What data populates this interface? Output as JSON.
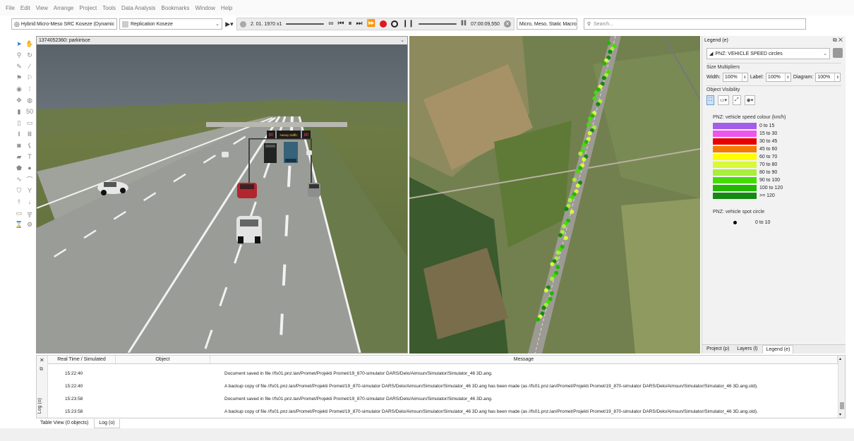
{
  "menu": [
    "File",
    "Edit",
    "View",
    "Arrange",
    "Project",
    "Tools",
    "Data Analysis",
    "Bookmarks",
    "Window",
    "Help"
  ],
  "toolbar": {
    "scenario": "Hybrid Micro-Meso SRC Koseze (Dynamic",
    "replication": "Replication Koseze",
    "date_speed": "2. 01. 1970 x1",
    "infinity": "∞",
    "time": "07:00:09,550",
    "engine": "Micro, Meso, Static Macro",
    "search_placeholder": "Search..."
  },
  "view3d": {
    "title": "1374052360: parkirisce",
    "sign_label": "Heavy traffic",
    "sign_speed": "80"
  },
  "legend": {
    "title": "Legend (e)",
    "selector": "PNZ: VEHICLE SPEED circles",
    "size_multipliers": "Size Multipliers",
    "width_label": "Width:",
    "width_value": "100%",
    "label_label": "Label:",
    "label_value": "100%",
    "diagram_label": "Diagram:",
    "diagram_value": "100%",
    "object_visibility": "Object Visibility",
    "speed_title": "PNZ: vehicle speed colour (km/h)",
    "speed_ranges": [
      {
        "label": "0 to 15",
        "color": "#a35de8"
      },
      {
        "label": "15 to 30",
        "color": "#ee55ee"
      },
      {
        "label": "30 to 45",
        "color": "#e80000"
      },
      {
        "label": "45 to 60",
        "color": "#f47a00"
      },
      {
        "label": "60 to 70",
        "color": "#ffff00"
      },
      {
        "label": "70 to 80",
        "color": "#d8f83a"
      },
      {
        "label": "80 to 90",
        "color": "#a8ee3a"
      },
      {
        "label": "90 to 100",
        "color": "#44dd00"
      },
      {
        "label": "100 to 120",
        "color": "#22b800"
      },
      {
        "label": ">= 120",
        "color": "#148a10"
      }
    ],
    "spot_title": "PNZ: vehicle spot circle",
    "spot_label": "0 to 10",
    "tabs": [
      "Project (p)",
      "Layers (l)",
      "Legend (e)"
    ]
  },
  "log": {
    "columns": [
      "Real Time / Simulated",
      "Object",
      "Message"
    ],
    "side_label": "Log (o)",
    "rows": [
      {
        "time": "15:22:40",
        "object": "",
        "message": "Document saved in file //fs01.pnz.lan/Promet/Projekti Promet/19_870-simulator DARS/Delo/Aimsun/Simulator/Simulator_46 3D.ang."
      },
      {
        "time": "15:22:40",
        "object": "",
        "message": "A backup copy of file //fs01.pnz.lan/Promet/Projekti Promet/19_870-simulator DARS/Delo/Aimsun/Simulator/Simulator_46 3D.ang has been made (as //fs01.pnz.lan/Promet/Projekti Promet/19_870-simulator DARS/Delo/Aimsun/Simulator/Simulator_46 3D.ang.old)."
      },
      {
        "time": "15:23:58",
        "object": "",
        "message": "Document saved in file //fs01.pnz.lan/Promet/Projekti Promet/19_870-simulator DARS/Delo/Aimsun/Simulator/Simulator_46 3D.ang."
      },
      {
        "time": "15:23:58",
        "object": "",
        "message": "A backup copy of file //fs01.pnz.lan/Promet/Projekti Promet/19_870-simulator DARS/Delo/Aimsun/Simulator/Simulator_46 3D.ang has been made (as //fs01.pnz.lan/Promet/Projekti Promet/19_870-simulator DARS/Delo/Aimsun/Simulator/Simulator_46 3D.ang.old)."
      }
    ]
  },
  "bottom_tabs": [
    "Table View (0 objects)",
    "Log (o)"
  ],
  "tools": [
    "select-arrow",
    "pan-hand",
    "zoom-lens",
    "rotate",
    "pen",
    "brush",
    "flag",
    "flag-2",
    "node",
    "grid",
    "junction",
    "sensor",
    "meter",
    "speed-50",
    "detector",
    "bus-stop",
    "lanes",
    "lanes-2",
    "camera",
    "signal",
    "polygon",
    "text",
    "shape",
    "circle",
    "curve",
    "curve-2",
    "shield",
    "fork",
    "pin",
    "arrow-down",
    "vms",
    "gantry",
    "hourglass",
    "gear"
  ]
}
